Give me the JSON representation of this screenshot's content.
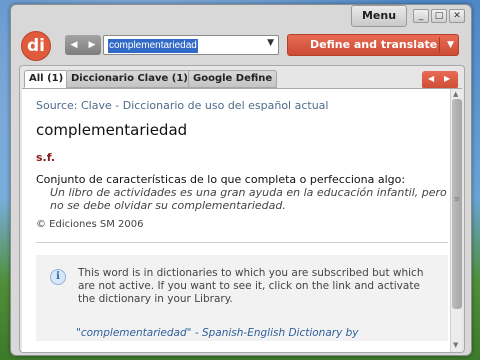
{
  "window": {
    "menu_label": "Menu",
    "controls": {
      "minimize": "_",
      "restore": "□",
      "close": "✕"
    }
  },
  "toolbar": {
    "logo_text": "di",
    "nav_back": "◀",
    "nav_forward": "▶",
    "search_value": "complementariedad",
    "dropdown_glyph": "▼",
    "define_label": "Define and translate",
    "define_dropdown_glyph": "▼"
  },
  "tabs": [
    {
      "label": "All (1)",
      "active": true
    },
    {
      "label": "Diccionario Clave (1)",
      "active": false
    },
    {
      "label": "Google Define",
      "active": false
    }
  ],
  "tab_nav": {
    "prev": "◀",
    "next": "▶"
  },
  "entry": {
    "source_prefix": "Source:",
    "source_name": "Clave - Diccionario de uso del español actual",
    "headword": "complementariedad",
    "part_of_speech": "s.f.",
    "definition": "Conjunto de características de lo que completa o perfecciona algo:",
    "example": "Un libro de actividades es una gran ayuda en la educación infantil, pero no se debe olvidar su complementariedad.",
    "copyright": "© Ediciones SM 2006"
  },
  "notice": {
    "icon_glyph": "i",
    "text": "This word is in dictionaries to which you are subscribed but which are not active. If you want to see it, click on the link and activate the dictionary in your Library.",
    "link": "\"complementariedad\" - Spanish-English Dictionary by"
  },
  "scrollbar": {
    "up": "▲",
    "down": "▼",
    "grip": "≡"
  },
  "colors": {
    "accent": "#cc4b33",
    "logo": "#e05a3c",
    "source_text": "#4e6c8a",
    "part_of_speech": "#8b1a1a",
    "link": "#2f5f9c"
  }
}
